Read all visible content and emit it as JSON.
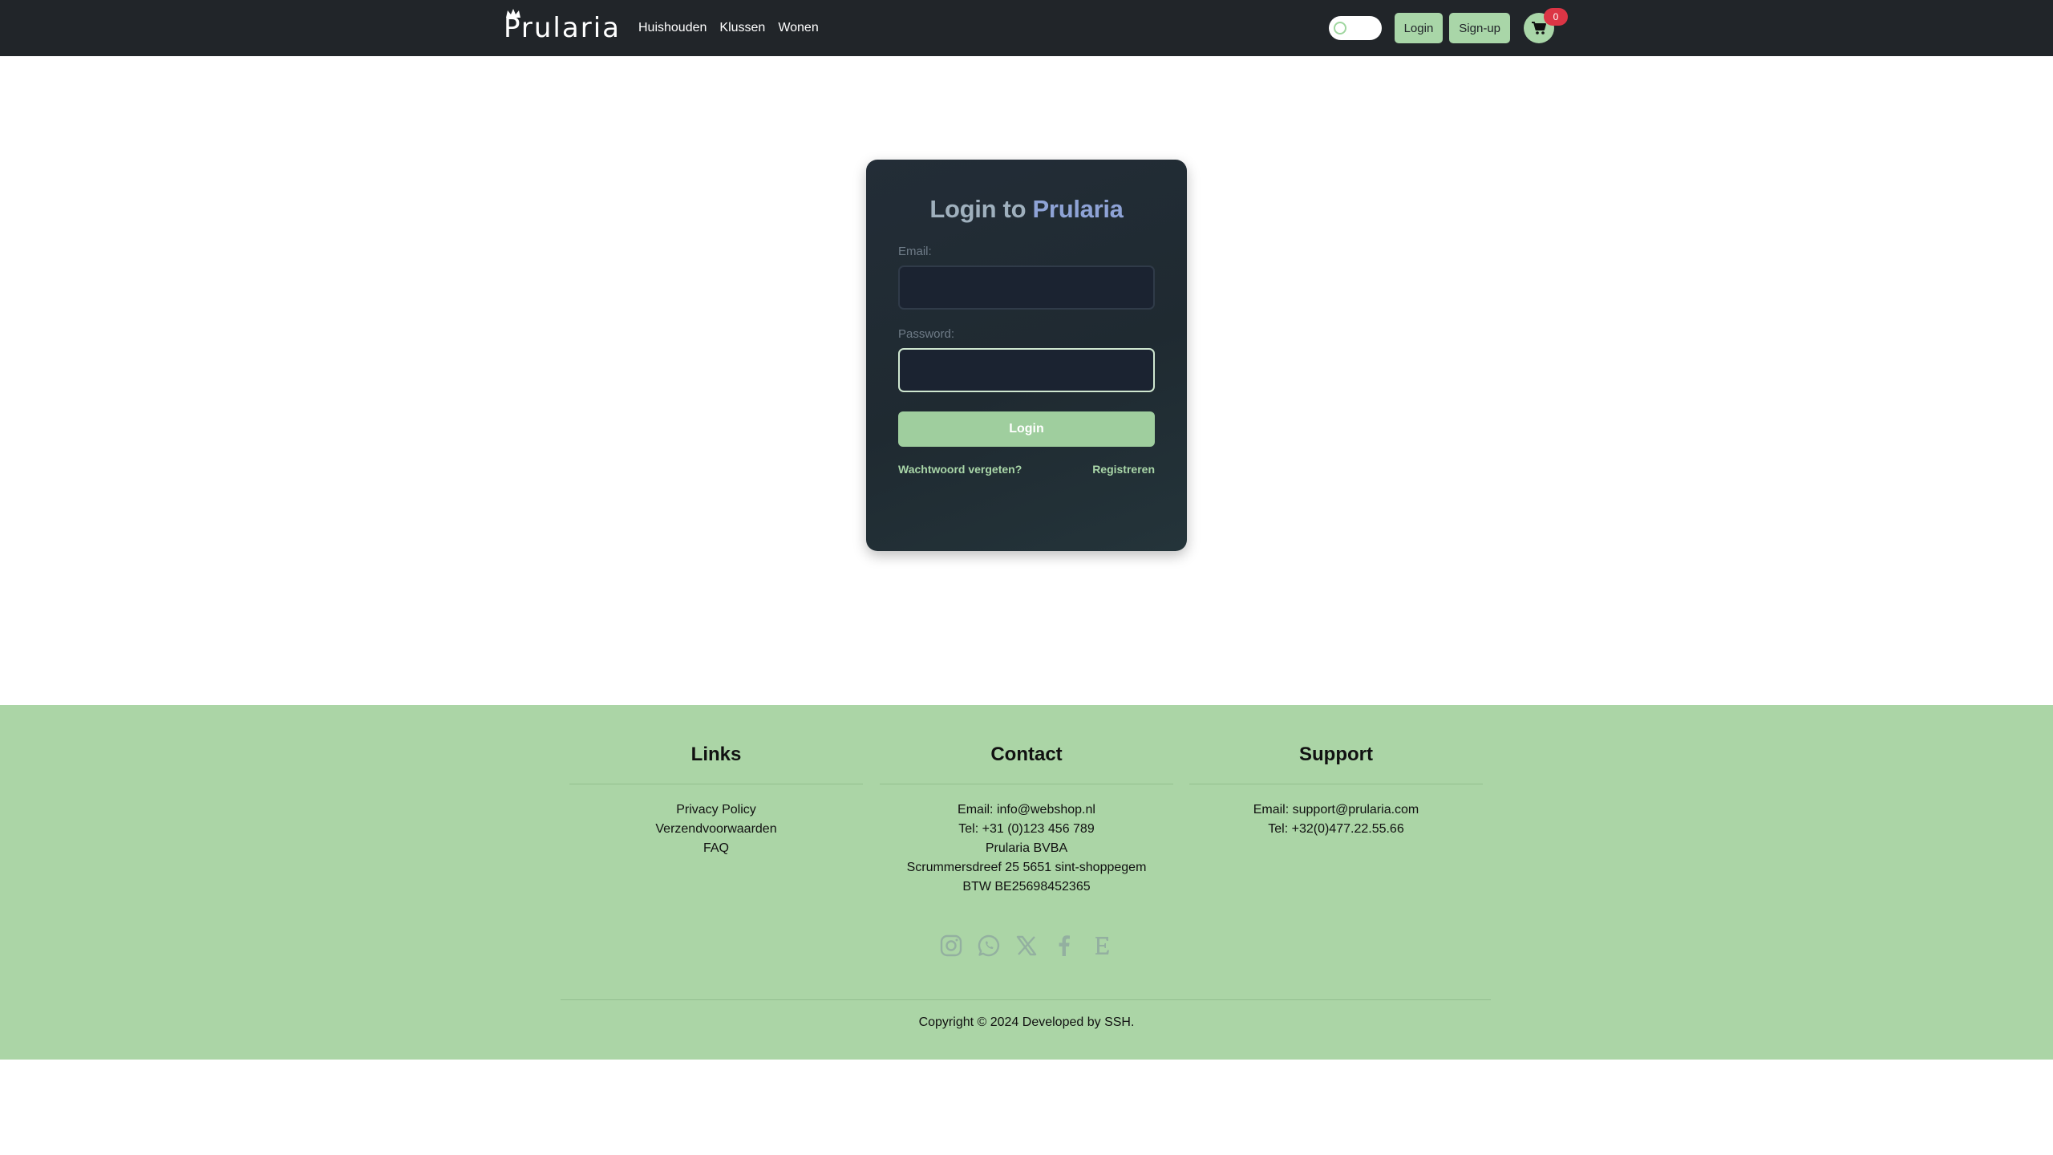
{
  "navbar": {
    "brand": "Prularia",
    "links": [
      "Huishouden",
      "Klussen",
      "Wonen"
    ],
    "login_label": "Login",
    "signup_label": "Sign-up",
    "cart_count": "0"
  },
  "login": {
    "title_prefix": "Login to ",
    "title_brand": "Prularia",
    "email_label": "Email:",
    "email_value": "",
    "password_label": "Password:",
    "password_value": "",
    "submit_label": "Login",
    "forgot_label": "Wachtwoord vergeten?",
    "register_label": "Registreren"
  },
  "footer": {
    "links": {
      "heading": "Links",
      "items": [
        "Privacy Policy",
        "Verzendvoorwaarden",
        "FAQ"
      ]
    },
    "contact": {
      "heading": "Contact",
      "items": [
        "Email: info@webshop.nl",
        "Tel: +31 (0)123 456 789",
        "Prularia BVBA",
        "Scrummersdreef 25 5651 sint-shoppegem",
        "BTW BE25698452365"
      ]
    },
    "support": {
      "heading": "Support",
      "items": [
        "Email: support@prularia.com",
        "Tel: +32(0)477.22.55.66"
      ]
    },
    "socials": [
      "instagram-icon",
      "whatsapp-icon",
      "x-icon",
      "facebook-icon",
      "etsy-icon"
    ],
    "copyright": "Copyright © 2024 Developed by SSH."
  },
  "colors": {
    "navbar_bg": "#212529",
    "accent_green": "#a9d6a8",
    "footer_bg": "#abd5a6",
    "badge_red": "#dc3545",
    "card_bg": "#232d37"
  }
}
